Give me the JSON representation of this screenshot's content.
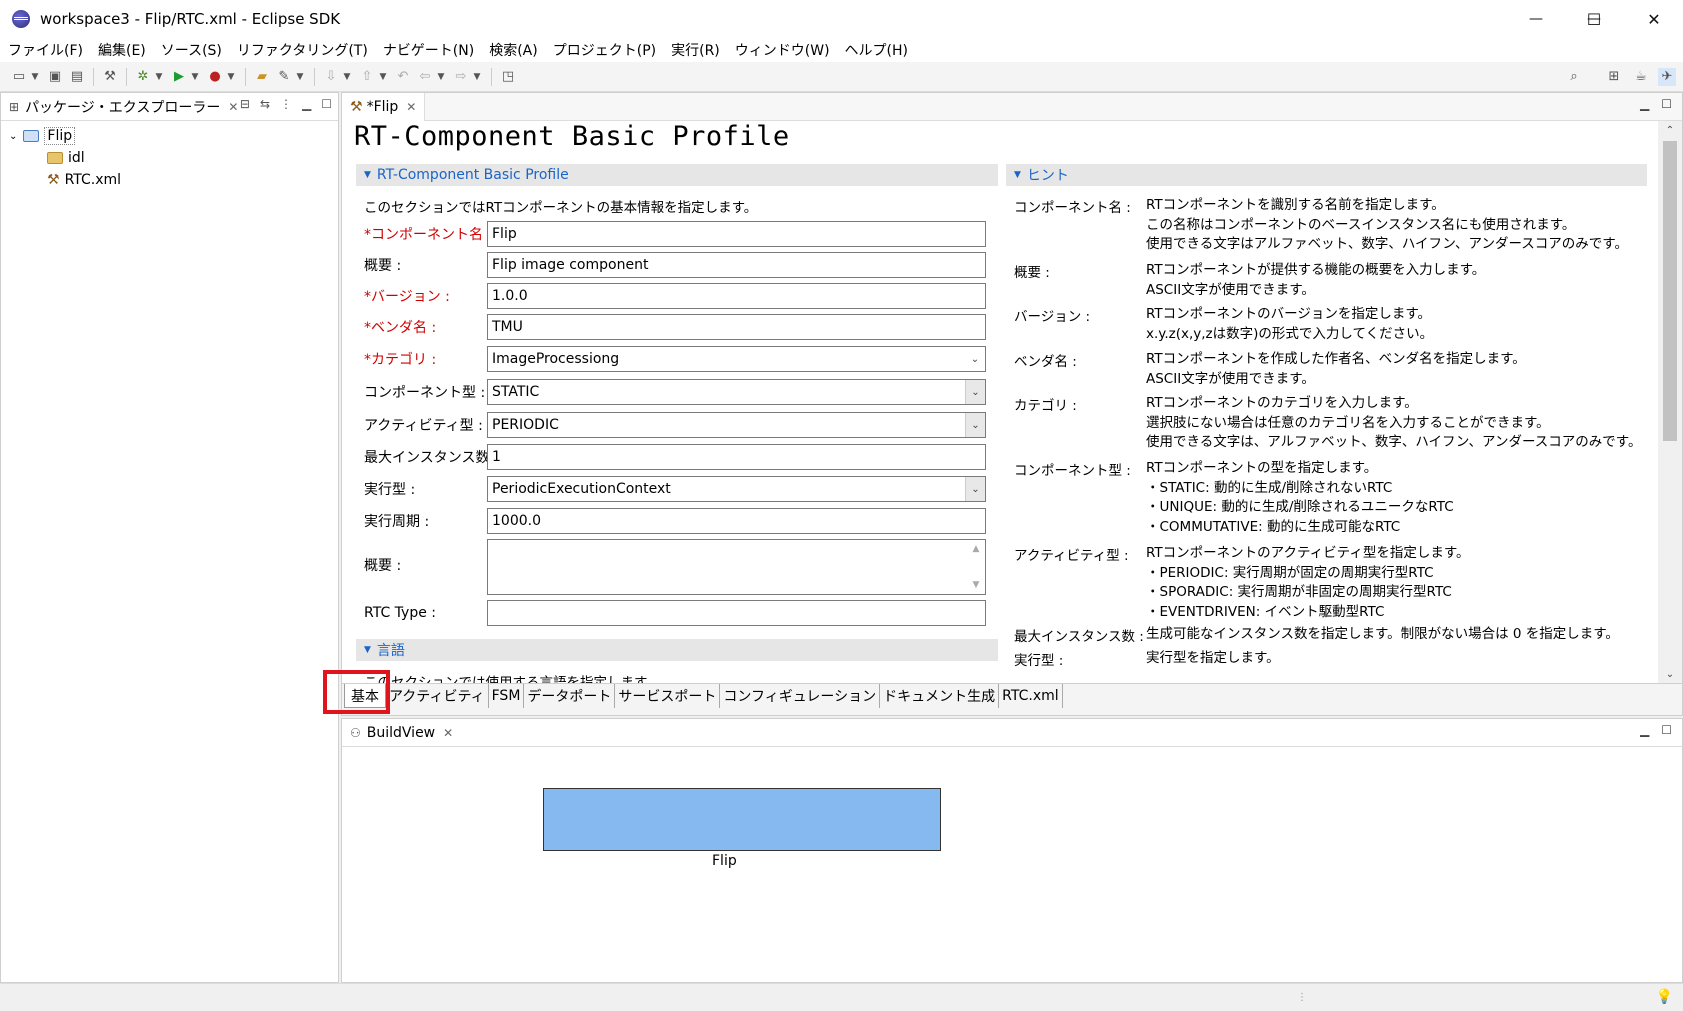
{
  "window": {
    "title": "workspace3 - Flip/RTC.xml - Eclipse SDK",
    "minimize": "—",
    "maximize": "☐",
    "close": "✕"
  },
  "menu": [
    "ファイル(F)",
    "編集(E)",
    "ソース(S)",
    "リファクタリング(T)",
    "ナビゲート(N)",
    "検索(A)",
    "プロジェクト(P)",
    "実行(R)",
    "ウィンドウ(W)",
    "ヘルプ(H)"
  ],
  "explorer": {
    "tab_label": "パッケージ・エクスプローラー",
    "tree": {
      "project": "Flip",
      "children": [
        "idl",
        "RTC.xml"
      ]
    }
  },
  "editor": {
    "tab_label": "*Flip",
    "page_title": "RT-Component Basic Profile",
    "section_title": "RT-Component Basic Profile",
    "section_desc": "このセクションではRTコンポーネントの基本情報を指定します。",
    "fields": {
      "component_name": {
        "label": "*コンポーネント名 :",
        "value": "Flip"
      },
      "description": {
        "label": "概要 :",
        "value": "Flip image component"
      },
      "version": {
        "label": "*バージョン :",
        "value": "1.0.0"
      },
      "vendor": {
        "label": "*ベンダ名 :",
        "value": "TMU"
      },
      "category": {
        "label": "*カテゴリ :",
        "value": "ImageProcessiong"
      },
      "component_type": {
        "label": "コンポーネント型 :",
        "value": "STATIC"
      },
      "activity_type": {
        "label": "アクティビティ型 :",
        "value": "PERIODIC"
      },
      "max_instances": {
        "label": "最大インスタンス数 :",
        "value": "1"
      },
      "execution_type": {
        "label": "実行型 :",
        "value": "PeriodicExecutionContext"
      },
      "execution_rate": {
        "label": "実行周期 :",
        "value": "1000.0"
      },
      "abstract": {
        "label": "概要 :",
        "value": ""
      },
      "rtc_type": {
        "label": "RTC Type :",
        "value": ""
      }
    },
    "language_section_title": "言語",
    "language_section_desc": "このセクションでは使用する言語を指定します",
    "hint_title": "ヒント",
    "hints": [
      {
        "key": "コンポーネント名 :",
        "lines": [
          "RTコンポーネントを識別する名前を指定します。",
          "この名称はコンポーネントのベースインスタンス名にも使用されます。",
          "使用できる文字はアルファベット、数字、ハイフン、アンダースコアのみです。"
        ]
      },
      {
        "key": "概要 :",
        "lines": [
          "RTコンポーネントが提供する機能の概要を入力します。",
          "ASCII文字が使用できます。"
        ]
      },
      {
        "key": "バージョン :",
        "lines": [
          "RTコンポーネントのバージョンを指定します。",
          "x.y.z(x,y,zは数字)の形式で入力してください。"
        ]
      },
      {
        "key": "ベンダ名 :",
        "lines": [
          "RTコンポーネントを作成した作者名、ベンダ名を指定します。",
          "ASCII文字が使用できます。"
        ]
      },
      {
        "key": "カテゴリ :",
        "lines": [
          "RTコンポーネントのカテゴリを入力します。",
          "選択肢にない場合は任意のカテゴリ名を入力することができます。",
          "使用できる文字は、アルファベット、数字、ハイフン、アンダースコアのみです。"
        ]
      },
      {
        "key": "コンポーネント型 :",
        "lines": [
          "RTコンポーネントの型を指定します。",
          "・STATIC: 動的に生成/削除されないRTC",
          "・UNIQUE: 動的に生成/削除されるユニークなRTC",
          "・COMMUTATIVE: 動的に生成可能なRTC"
        ]
      },
      {
        "key": "アクティビティ型 :",
        "lines": [
          "RTコンポーネントのアクティビティ型を指定します。",
          "・PERIODIC: 実行周期が固定の周期実行型RTC",
          "・SPORADIC: 実行周期が非固定の周期実行型RTC",
          "・EVENTDRIVEN: イベント駆動型RTC"
        ]
      },
      {
        "key": "最大インスタンス数 :",
        "lines": [
          "生成可能なインスタンス数を指定します。制限がない場合は 0 を指定します。"
        ]
      },
      {
        "key": "実行型 :",
        "lines": [
          "実行型を指定します。"
        ]
      }
    ],
    "page_tabs": [
      "基本",
      "アクティビティ",
      "FSM",
      "データポート",
      "サービスポート",
      "コンフィギュレーション",
      "ドキュメント生成",
      "RTC.xml"
    ],
    "active_page_tab": "基本"
  },
  "buildview": {
    "tab_label": "BuildView",
    "component_label": "Flip",
    "component_color": "#85b9ef"
  },
  "colors": {
    "required_label": "#d00000",
    "section_title": "#1a64c8",
    "highlight": "#e0141c"
  }
}
